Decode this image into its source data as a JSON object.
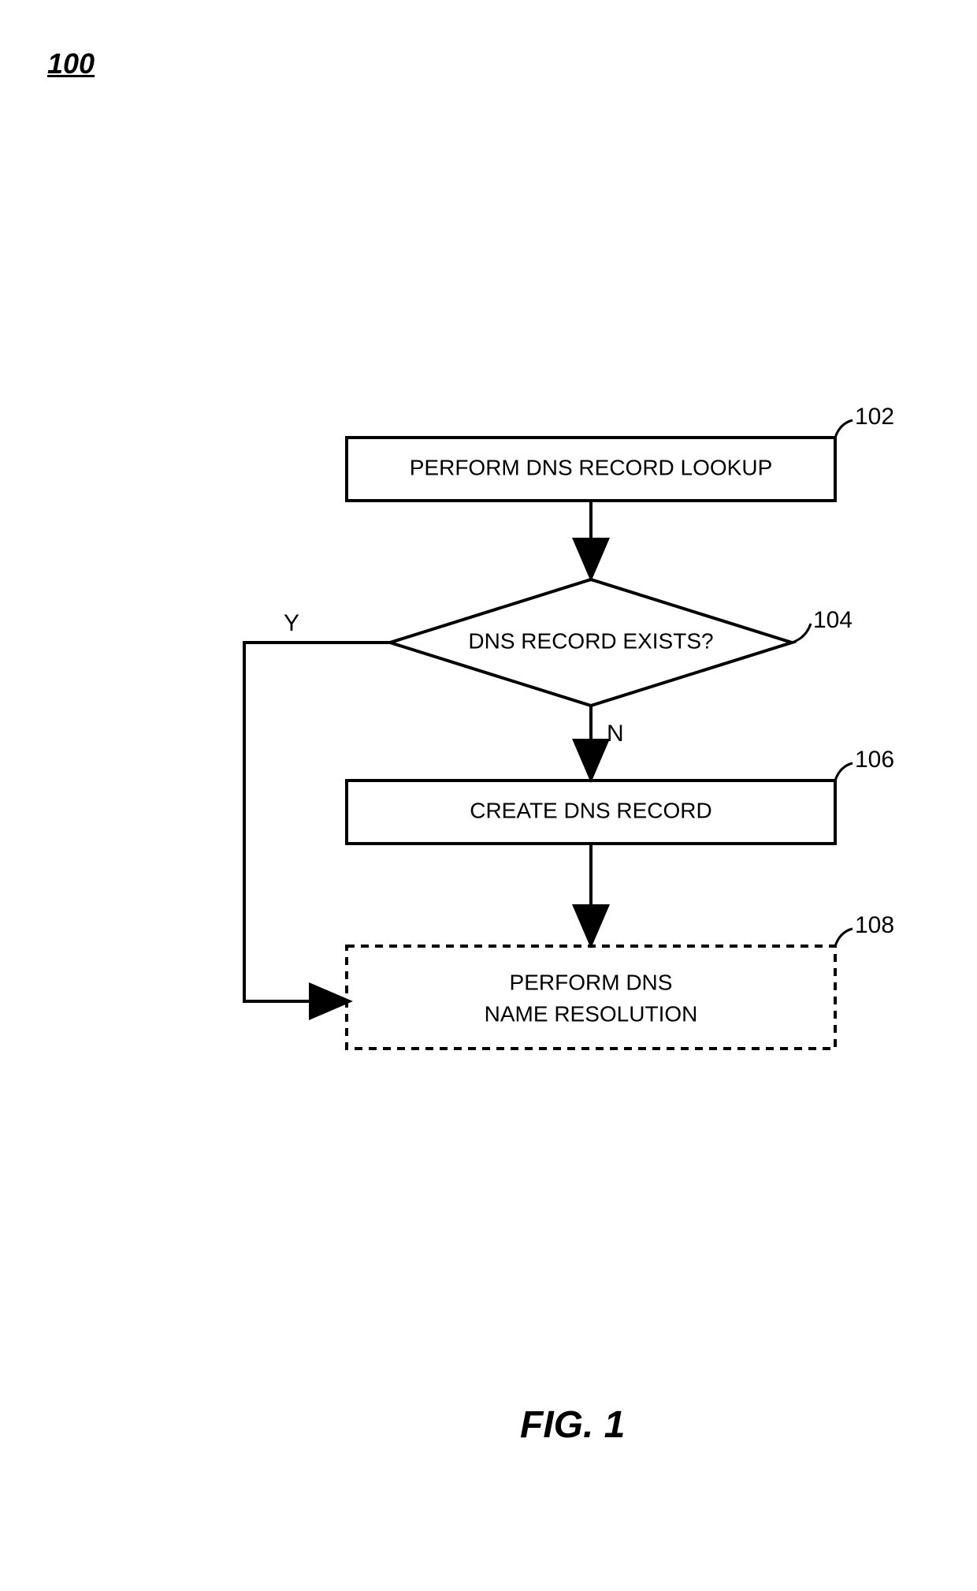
{
  "figure_number": "100",
  "caption": "FIG. 1",
  "nodes": {
    "n102": {
      "label": "PERFORM DNS RECORD LOOKUP",
      "ref": "102"
    },
    "n104": {
      "label": "DNS RECORD EXISTS?",
      "ref": "104"
    },
    "n106": {
      "label": "CREATE DNS RECORD",
      "ref": "106"
    },
    "n108": {
      "label_line1": "PERFORM DNS",
      "label_line2": "NAME RESOLUTION",
      "ref": "108"
    }
  },
  "branches": {
    "yes": "Y",
    "no": "N"
  }
}
